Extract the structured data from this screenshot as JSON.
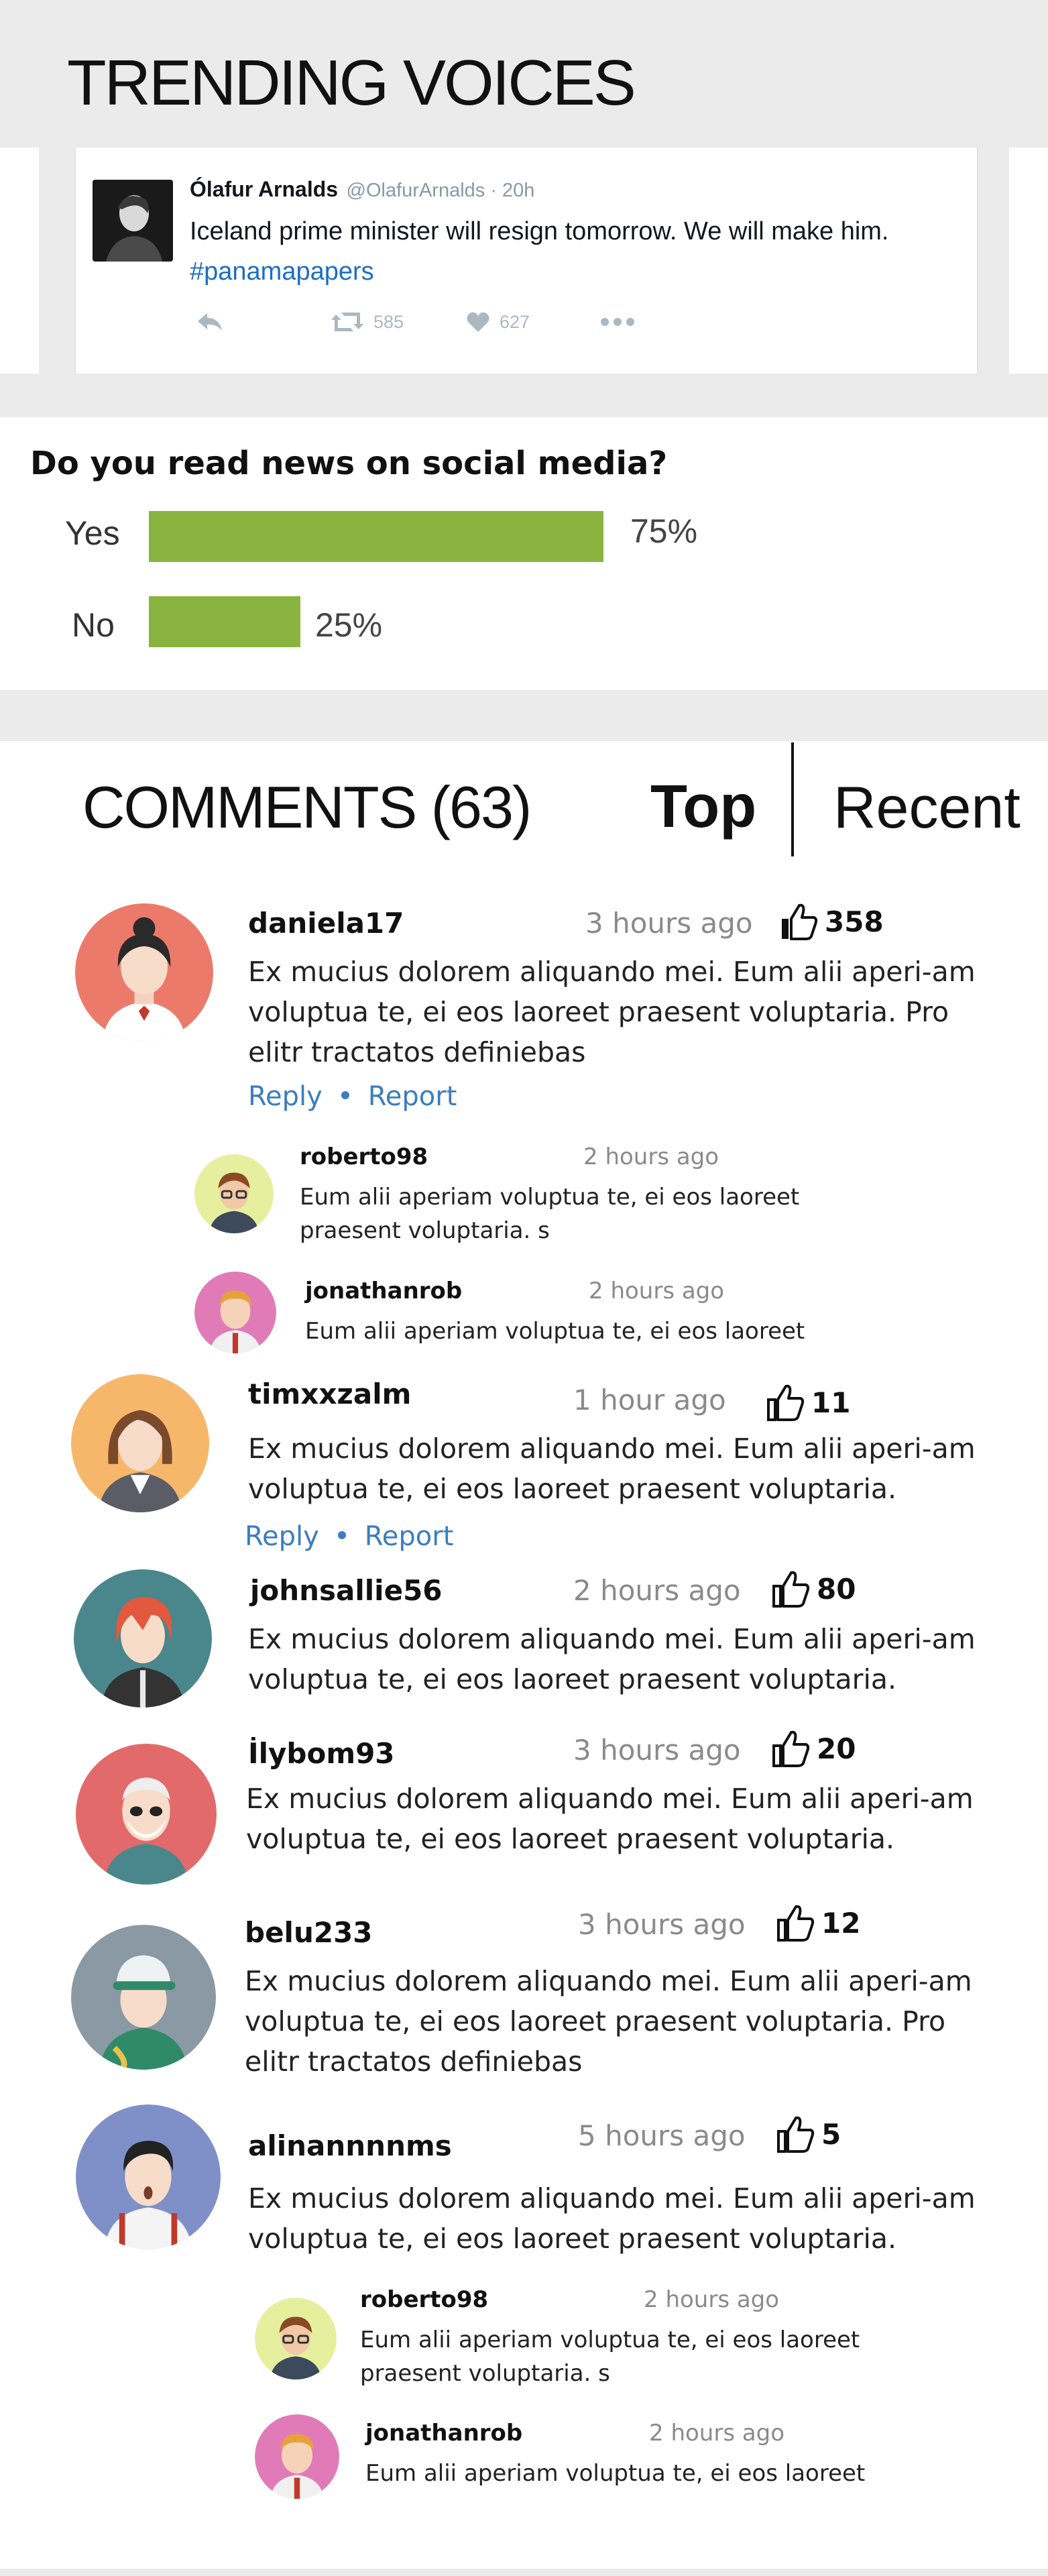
{
  "trending": {
    "title": "TRENDING VOICES",
    "tweet": {
      "author_name": "Ólafur Arnalds",
      "meta": "@OlafurArnalds · 20h",
      "text": "Iceland prime minister will resign tomorrow. We will make him.",
      "hashtag": "#panamapapers",
      "retweets": "585",
      "likes": "627"
    }
  },
  "poll": {
    "question": "Do you read news on social media?",
    "options": [
      {
        "label": "Yes",
        "percent_text": "75%",
        "value": 75
      },
      {
        "label": "No",
        "percent_text": "25%",
        "value": 25
      }
    ],
    "bar_color": "#8ab440"
  },
  "comments": {
    "title": "COMMENTS (63)",
    "tab_top": "Top",
    "tab_recent": "Recent",
    "reply_label": "Reply",
    "report_label": "Report",
    "link_color": "#3c7dbd",
    "items": [
      {
        "user": "daniela17",
        "time": "3 hours ago",
        "likes": "358",
        "text": "Ex mucius dolorem aliquando mei. Eum alii aperi-am voluptua te, ei eos laoreet praesent voluptaria. Pro elitr tractatos definiebas",
        "replies": [
          {
            "user": "roberto98",
            "time": "2 hours ago",
            "text": "Eum alii aperiam voluptua te, ei eos laoreet praesent voluptaria. s"
          },
          {
            "user": "jonathanrob",
            "time": "2 hours ago",
            "text": "Eum alii aperiam voluptua te, ei eos laoreet"
          }
        ]
      },
      {
        "user": "timxxzalm",
        "time": "1 hour ago",
        "likes": "11",
        "text": "Ex mucius dolorem aliquando mei. Eum alii aperi-am voluptua te, ei eos laoreet praesent voluptaria."
      },
      {
        "user": "johnsallie56",
        "time": "2 hours ago",
        "likes": "80",
        "text": "Ex mucius dolorem aliquando mei. Eum alii aperi-am voluptua te, ei eos laoreet praesent voluptaria."
      },
      {
        "user": "İlybom93",
        "time": "3 hours ago",
        "likes": "20",
        "text": "Ex mucius dolorem aliquando mei. Eum alii aperi-am voluptua te, ei eos laoreet praesent voluptaria."
      },
      {
        "user": "belu233",
        "time": "3 hours ago",
        "likes": "12",
        "text": "Ex mucius dolorem aliquando mei. Eum alii aperi-am voluptua te, ei eos laoreet praesent voluptaria. Pro elitr tractatos definiebas"
      },
      {
        "user": "alinannnnms",
        "time": "5 hours ago",
        "likes": "5",
        "text": "Ex mucius dolorem aliquando mei. Eum alii aperi-am voluptua te, ei eos laoreet praesent voluptaria.",
        "replies": [
          {
            "user": "roberto98",
            "time": "2 hours ago",
            "text": "Eum alii aperiam voluptua te, ei eos laoreet praesent voluptaria. s"
          },
          {
            "user": "jonathanrob",
            "time": "2 hours ago",
            "text": "Eum alii aperiam voluptua te, ei eos laoreet"
          }
        ]
      }
    ]
  },
  "icons": {
    "like": "thumbs-up-icon",
    "tweet_reply": "reply-arrow-icon",
    "tweet_retweet": "retweet-icon",
    "tweet_like": "heart-icon",
    "tweet_more": "more-dots-icon"
  }
}
